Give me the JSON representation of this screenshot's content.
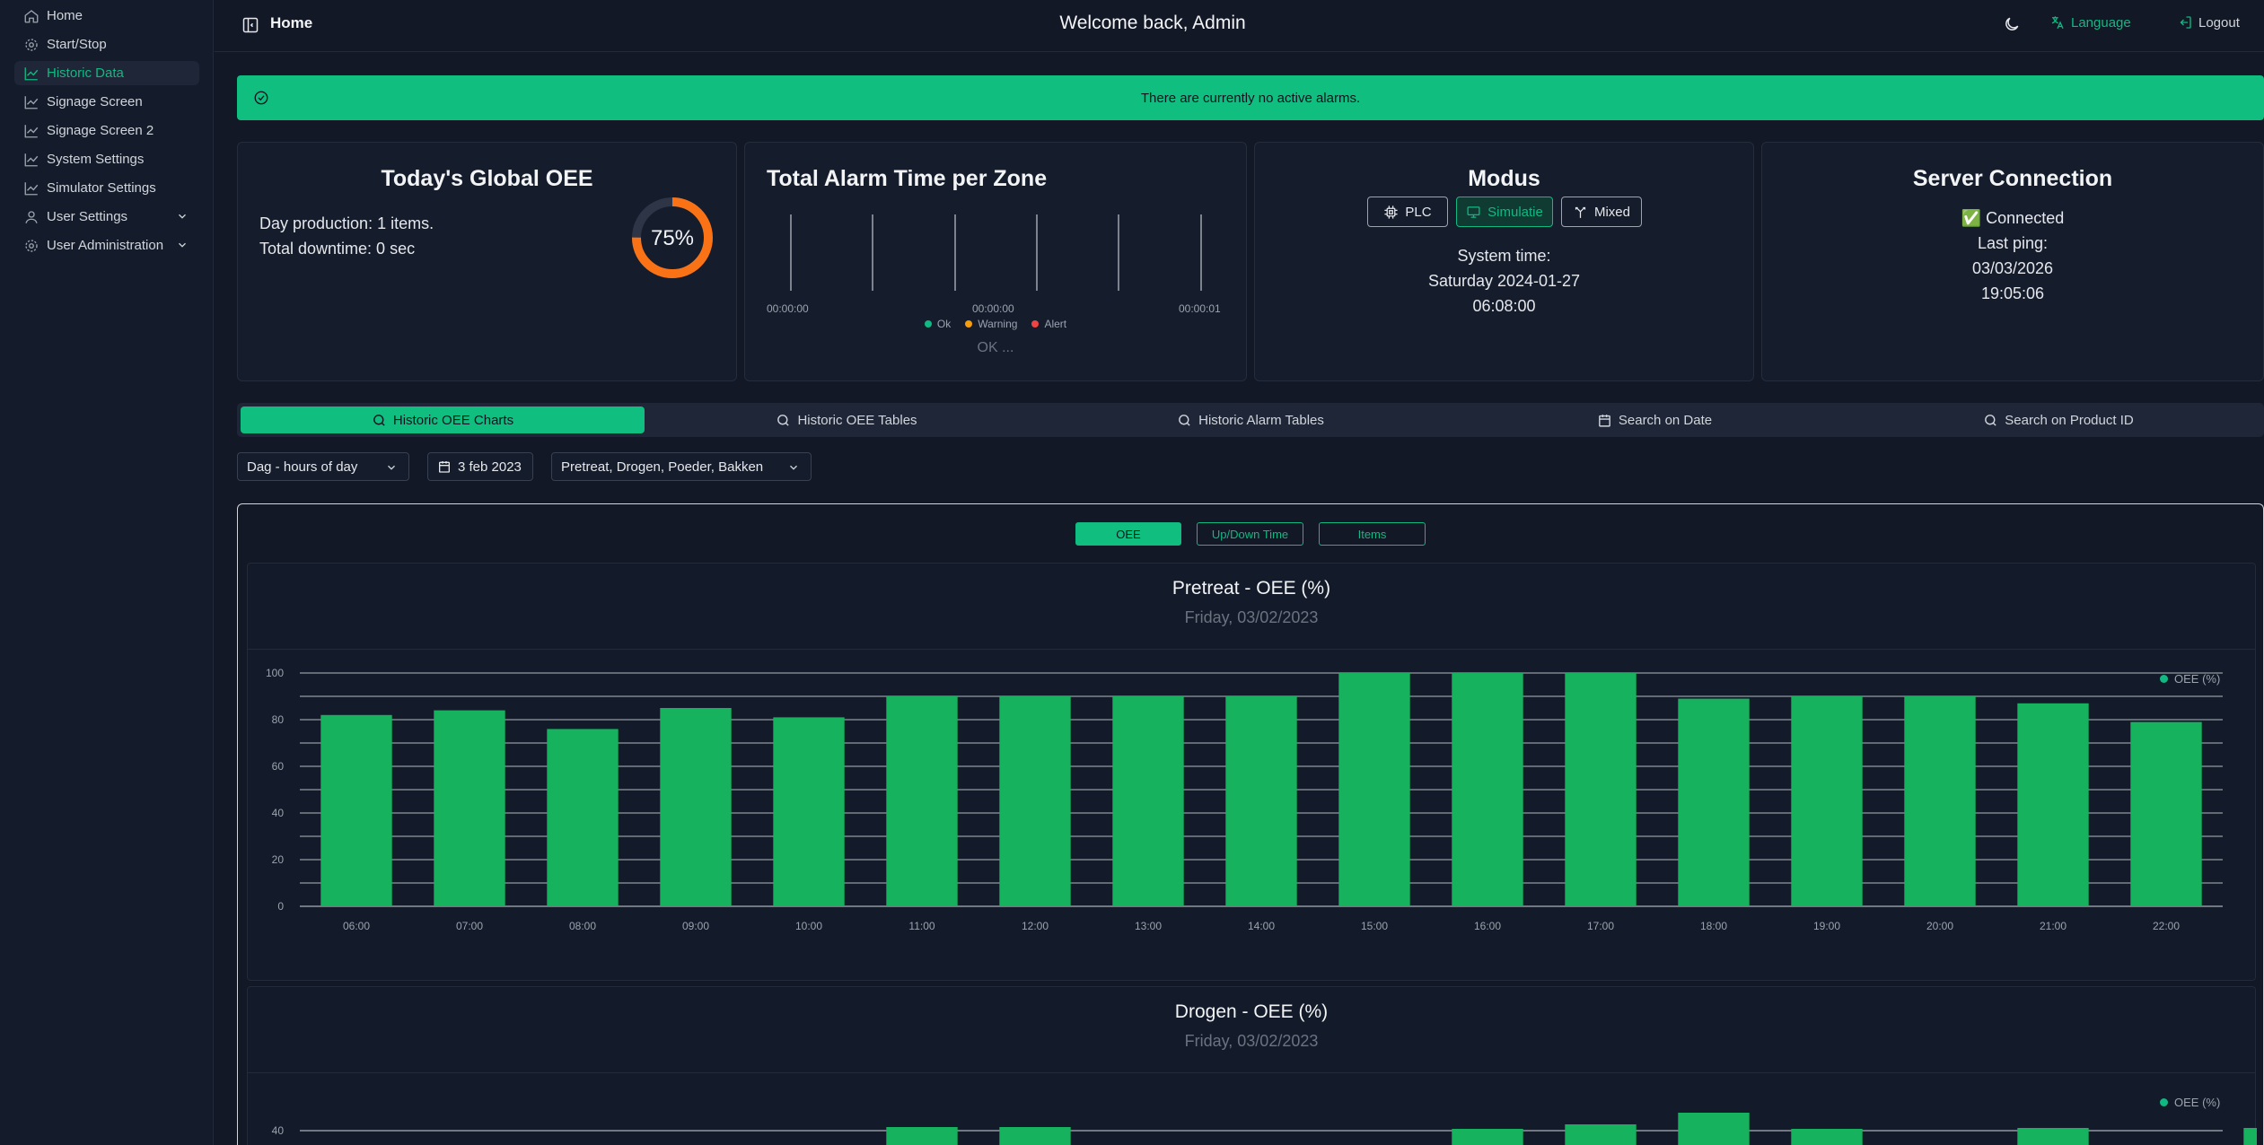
{
  "sidebar": {
    "items": [
      {
        "label": "Home",
        "icon": "home-icon"
      },
      {
        "label": "Start/Stop",
        "icon": "gear-icon"
      },
      {
        "label": "Historic Data",
        "icon": "chart-icon"
      },
      {
        "label": "Signage Screen",
        "icon": "chart-icon"
      },
      {
        "label": "Signage Screen 2",
        "icon": "chart-icon"
      },
      {
        "label": "System Settings",
        "icon": "chart-icon"
      },
      {
        "label": "Simulator Settings",
        "icon": "chart-icon"
      },
      {
        "label": "User Settings",
        "icon": "user-icon"
      },
      {
        "label": "User Administration",
        "icon": "gear-icon"
      }
    ],
    "active_index": 2
  },
  "header": {
    "title": "Home",
    "welcome": "Welcome back, Admin",
    "language": "Language",
    "logout": "Logout"
  },
  "banner": {
    "text": "There are currently no active alarms."
  },
  "oee_card": {
    "title": "Today's Global OEE",
    "production": "Day production: 1 items.",
    "downtime": "Total downtime: 0 sec",
    "gauge_label": "75%",
    "gauge_value": 0.75
  },
  "alarm_card": {
    "title": "Total Alarm Time per Zone",
    "ticks": [
      "00:00:00",
      "00:00:00",
      "00:00:01"
    ],
    "legend": [
      {
        "label": "Ok",
        "color": "#10b981"
      },
      {
        "label": "Warning",
        "color": "#f59e0b"
      },
      {
        "label": "Alert",
        "color": "#ef4444"
      }
    ],
    "status": "OK ..."
  },
  "modus_card": {
    "title": "Modus",
    "buttons": [
      "PLC",
      "Simulatie",
      "Mixed"
    ],
    "active_button": "Simulatie",
    "system_time_label": "System time:",
    "date": "Saturday 2024-01-27",
    "time": "06:08:00"
  },
  "server_card": {
    "title": "Server Connection",
    "status": "✅ Connected",
    "last_ping_label": "Last ping:",
    "ping_date": "03/03/2026",
    "ping_time": "19:05:06"
  },
  "tabs": [
    "Historic OEE Charts",
    "Historic OEE Tables",
    "Historic Alarm Tables",
    "Search on Date",
    "Search on Product ID"
  ],
  "filters": {
    "period": "Dag - hours of day",
    "date": "3 feb 2023",
    "zones": "Pretreat, Drogen, Poeder, Bakken"
  },
  "chart_toggles": [
    "OEE",
    "Up/Down Time",
    "Items"
  ],
  "colors": {
    "accent": "#10b981",
    "background": "#121826",
    "bar": "#16b25d"
  },
  "chart_data": [
    {
      "type": "bar",
      "title": "Pretreat - OEE (%)",
      "subtitle": "Friday, 03/02/2023",
      "categories": [
        "06:00",
        "07:00",
        "08:00",
        "09:00",
        "10:00",
        "11:00",
        "12:00",
        "13:00",
        "14:00",
        "15:00",
        "16:00",
        "17:00",
        "18:00",
        "19:00",
        "20:00",
        "21:00",
        "22:00"
      ],
      "series": [
        {
          "name": "OEE (%)",
          "values": [
            82,
            84,
            76,
            85,
            81,
            90,
            90,
            90,
            90,
            100,
            100,
            100,
            89,
            90,
            90,
            87,
            79
          ]
        }
      ],
      "yticks": [
        0,
        20,
        40,
        60,
        80,
        100
      ],
      "ylim": [
        0,
        100
      ],
      "grid": true,
      "legend_position": "top-right"
    },
    {
      "type": "bar",
      "title": "Drogen - OEE (%)",
      "subtitle": "Friday, 03/02/2023",
      "series": [
        {
          "name": "OEE (%)",
          "values": []
        }
      ],
      "yticks": [
        40
      ],
      "grid": true,
      "legend_position": "top-right"
    }
  ]
}
